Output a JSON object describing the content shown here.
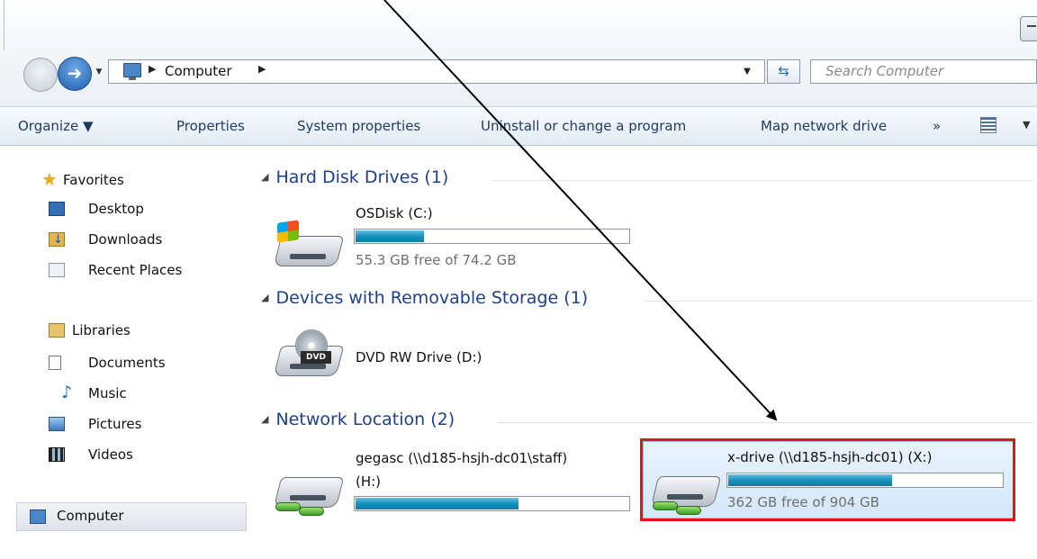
{
  "address_bar": {
    "path_label": "Computer",
    "search_placeholder": "Search Computer"
  },
  "command_bar": {
    "organize": "Organize ▼",
    "properties": "Properties",
    "system_properties": "System properties",
    "uninstall": "Uninstall or change a program",
    "map_network_drive": "Map network drive",
    "more": "»"
  },
  "nav_pane": {
    "favorites": {
      "label": "Favorites",
      "items": [
        "Desktop",
        "Downloads",
        "Recent Places"
      ]
    },
    "libraries": {
      "label": "Libraries",
      "items": [
        "Documents",
        "Music",
        "Pictures",
        "Videos"
      ]
    },
    "computer": "Computer"
  },
  "groups": {
    "hdd": {
      "header": "Hard Disk Drives (1)",
      "drives": [
        {
          "name": "OSDisk (C:)",
          "free_text": "55.3 GB free of 74.2 GB",
          "used_fraction": 0.255
        }
      ]
    },
    "removable": {
      "header": "Devices with Removable Storage (1)",
      "drives": [
        {
          "name": "DVD RW Drive (D:)",
          "icon_label": "DVD"
        }
      ]
    },
    "network": {
      "header": "Network Location (2)",
      "drives": [
        {
          "name_line1": "gegasc (\\\\d185-hsjh-dc01\\staff)",
          "name_line2": "(H:)",
          "used_fraction": 0.6
        },
        {
          "name": "x-drive (\\\\d185-hsjh-dc01) (X:)",
          "free_text": "362 GB free of 904 GB",
          "used_fraction": 0.6
        }
      ]
    }
  },
  "colors": {
    "highlight_box": "#e3151a",
    "group_header": "#1e3f8a",
    "bar_fill": "#1a8fbd"
  }
}
